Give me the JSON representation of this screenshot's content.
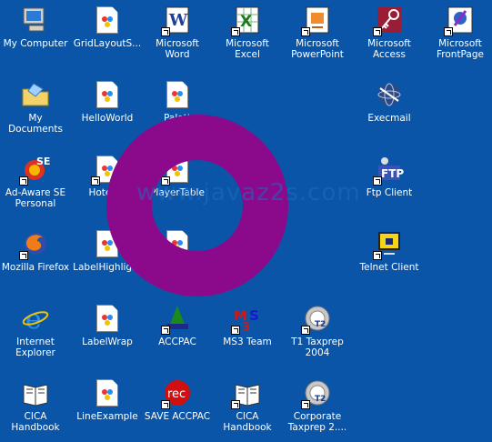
{
  "desktop": {
    "background": "#0a55a7",
    "icons": [
      {
        "label": "My Computer",
        "icon": "computer-icon",
        "shortcut": false
      },
      {
        "label": "GridLayoutS...",
        "icon": "java-file-icon",
        "shortcut": false
      },
      {
        "label": "Microsoft Word",
        "icon": "word-icon",
        "shortcut": true
      },
      {
        "label": "Microsoft Excel",
        "icon": "excel-icon",
        "shortcut": true
      },
      {
        "label": "Microsoft\nPowerPoint",
        "icon": "powerpoint-icon",
        "shortcut": true
      },
      {
        "label": "Microsoft\nAccess",
        "icon": "access-icon",
        "shortcut": true
      },
      {
        "label": "Microsoft\nFrontPage",
        "icon": "frontpage-icon",
        "shortcut": true
      },
      {
        "label": "My Documents",
        "icon": "folder-icon",
        "shortcut": false
      },
      {
        "label": "HelloWorld",
        "icon": "java-file-icon",
        "shortcut": false
      },
      {
        "label": "Palett",
        "icon": "java-file-icon",
        "shortcut": false
      },
      {
        "label": "Execmail",
        "icon": "globe-icon",
        "shortcut": false
      },
      {
        "label": "Ad-Aware SE\nPersonal",
        "icon": "adaware-icon",
        "shortcut": true
      },
      {
        "label": "HotelRe",
        "icon": "java-file-icon",
        "shortcut": true
      },
      {
        "label": "PlayerTable",
        "icon": "java-file-icon",
        "shortcut": true
      },
      {
        "label": "Ftp Client",
        "icon": "ftp-icon",
        "shortcut": true
      },
      {
        "label": "Mozilla Firefox",
        "icon": "firefox-icon",
        "shortcut": true
      },
      {
        "label": "LabelHighlight",
        "icon": "java-file-icon",
        "shortcut": false
      },
      {
        "label": "",
        "icon": "java-file-icon",
        "shortcut": true
      },
      {
        "label": "Telnet Client",
        "icon": "telnet-icon",
        "shortcut": true
      },
      {
        "label": "Internet\nExplorer",
        "icon": "ie-icon",
        "shortcut": false
      },
      {
        "label": "LabelWrap",
        "icon": "java-file-icon",
        "shortcut": false
      },
      {
        "label": "ACCPAC",
        "icon": "accpac-icon",
        "shortcut": true
      },
      {
        "label": "MS3 Team",
        "icon": "ms3-icon",
        "shortcut": true
      },
      {
        "label": "T1 Taxprep\n2004",
        "icon": "taxprep-icon",
        "shortcut": true
      },
      {
        "label": "CICA\nHandbook",
        "icon": "book-icon",
        "shortcut": false
      },
      {
        "label": "LineExample",
        "icon": "java-file-icon",
        "shortcut": false
      },
      {
        "label": "SAVE ACCPAC",
        "icon": "rec-icon",
        "shortcut": true
      },
      {
        "label": "CICA\nHandbook",
        "icon": "book-icon",
        "shortcut": true
      },
      {
        "label": "Corporate\nTaxprep 2....",
        "icon": "taxprep-icon",
        "shortcut": true
      }
    ]
  },
  "watermark": {
    "text": "www.javaz2s.com",
    "color": "#8b0a8c"
  }
}
